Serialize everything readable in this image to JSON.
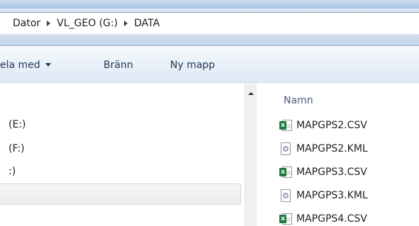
{
  "breadcrumb": {
    "items": [
      "Dator",
      "VL_GEO (G:)",
      "DATA"
    ]
  },
  "toolbar": {
    "share_label": "ela med",
    "burn_label": "Bränn",
    "new_folder_label": "Ny mapp"
  },
  "navigation": {
    "items": [
      "(E:)",
      "(F:)",
      ":)"
    ]
  },
  "file_list": {
    "column_header": "Namn",
    "files": [
      {
        "name": "MAPGPS2.CSV",
        "icon": "excel-csv-file-icon"
      },
      {
        "name": "MAPGPS2.KML",
        "icon": "kml-file-icon"
      },
      {
        "name": "MAPGPS3.CSV",
        "icon": "excel-csv-file-icon"
      },
      {
        "name": "MAPGPS3.KML",
        "icon": "kml-file-icon"
      },
      {
        "name": "MAPGPS4.CSV",
        "icon": "excel-csv-file-icon"
      }
    ]
  },
  "colors": {
    "csv_icon_badge": "#1f7a3c",
    "toolbar_text": "#1e3958",
    "column_header_text": "#4c607a"
  }
}
